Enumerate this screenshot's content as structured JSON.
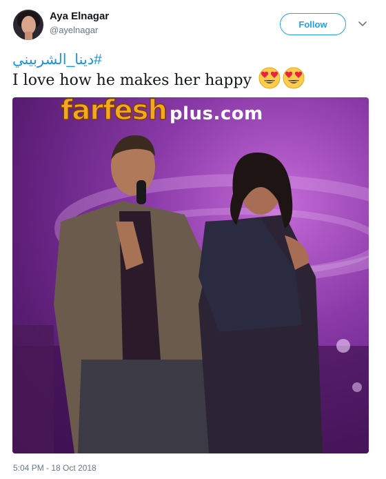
{
  "user": {
    "display_name": "Aya Elnagar",
    "handle": "@ayelnagar",
    "avatar": "profile-photo"
  },
  "follow_button": {
    "label": "Follow"
  },
  "tweet": {
    "hashtag": "#دينا_الشربيني",
    "text": "I love how he makes her happy",
    "emoji": [
      "heart-eyes-emoji",
      "heart-eyes-emoji"
    ]
  },
  "media": {
    "watermark_main": "farfesh",
    "watermark_sub": "plus.com"
  },
  "timestamp": "5:04 PM - 18 Oct 2018",
  "colors": {
    "accent": "#1da1f2",
    "hashtag": "#1b95e0",
    "muted": "#657786"
  },
  "icons": {
    "menu": "chevron-down-icon"
  }
}
